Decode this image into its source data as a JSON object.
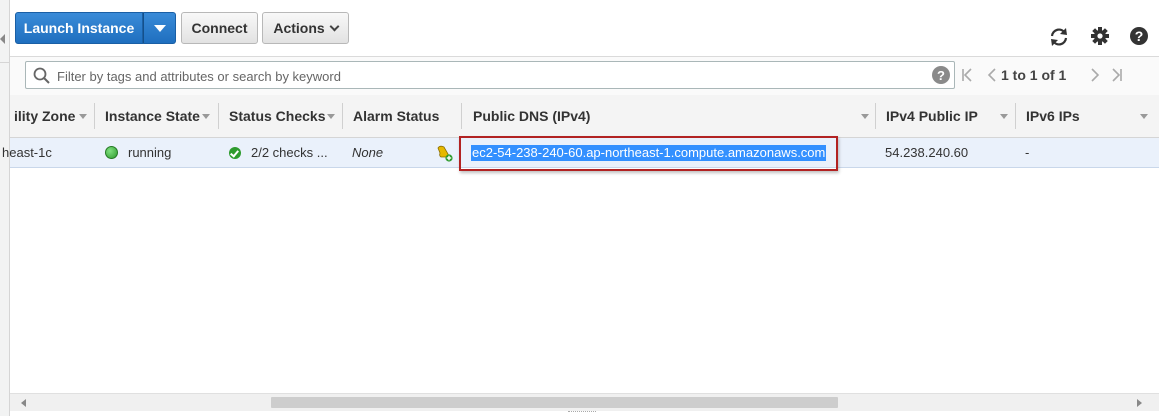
{
  "toolbar": {
    "launch_label": "Launch Instance",
    "connect_label": "Connect",
    "actions_label": "Actions"
  },
  "icons": {
    "refresh": "refresh-icon",
    "settings": "gear-icon",
    "help": "help-icon"
  },
  "filter": {
    "placeholder": "Filter by tags and attributes or search by keyword",
    "help_glyph": "?"
  },
  "pagination": {
    "text": "1 to 1 of 1"
  },
  "table": {
    "columns": [
      "ility Zone",
      "Instance State",
      "Status Checks",
      "Alarm Status",
      "Public DNS (IPv4)",
      "IPv4 Public IP",
      "IPv6 IPs"
    ],
    "rows": [
      {
        "availability_zone": "heast-1c",
        "instance_state": "running",
        "status_checks": "2/2 checks ...",
        "alarm_status": "None",
        "public_dns": "ec2-54-238-240-60.ap-northeast-1.compute.amazonaws.com",
        "ipv4_public_ip": "54.238.240.60",
        "ipv6_ips": "-"
      }
    ]
  },
  "colors": {
    "primary_button": "#1f6fbf",
    "running_status": "#2e9b2e",
    "highlight_box": "#b22222",
    "selection": "#3390ff",
    "row_selected": "#eaf1fb"
  }
}
